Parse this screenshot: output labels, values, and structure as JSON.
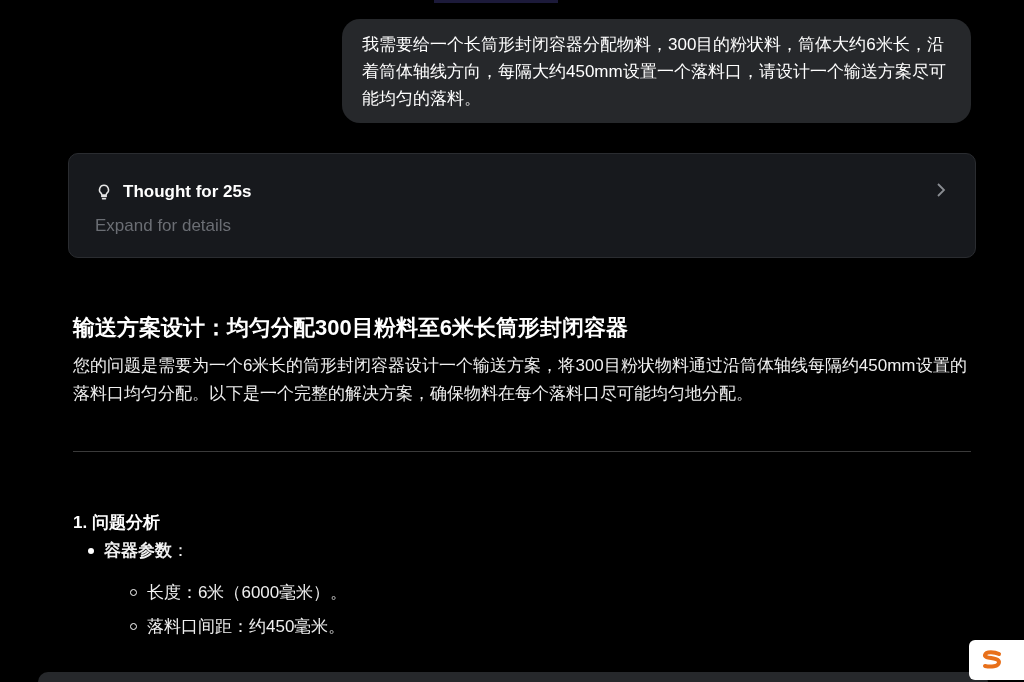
{
  "user_message": "我需要给一个长筒形封闭容器分配物料，300目的粉状料，筒体大约6米长，沿着筒体轴线方向，每隔大约450mm设置一个落料口，请设计一个输送方案尽可能均匀的落料。",
  "thought": {
    "title": "Thought for 25s",
    "subtitle": "Expand for details",
    "expanded": false
  },
  "answer": {
    "heading": "输送方案设计：均匀分配300目粉料至6米长筒形封闭容器",
    "intro": "您的问题是需要为一个6米长的筒形封闭容器设计一个输送方案，将300目粉状物料通过沿筒体轴线每隔约450mm设置的落料口均匀分配。以下是一个完整的解决方案，确保物料在每个落料口尽可能均匀地分配。",
    "section_title": "1. 问题分析",
    "bullets": [
      {
        "text": "**容器参数**：",
        "children": [
          {
            "text": "长度：6米（6000毫米）。"
          },
          {
            "text": "落料口间距：约450毫米。"
          }
        ]
      }
    ]
  }
}
